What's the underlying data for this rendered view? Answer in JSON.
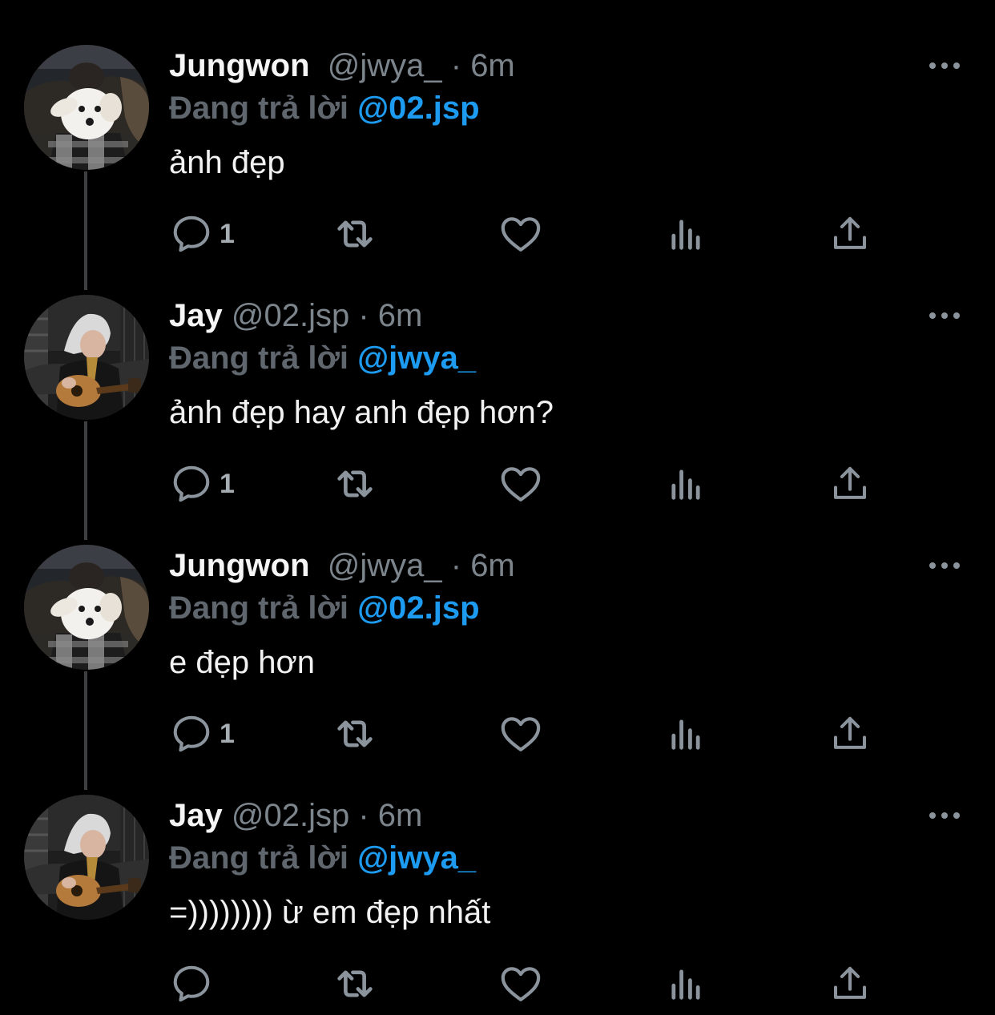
{
  "colors": {
    "background": "#000000",
    "name": "#f5f5f5",
    "meta": "#7c848c",
    "replying": "#5f666d",
    "mention": "#1d9bf0",
    "icon": "#8b949c",
    "thread_line": "#3d3f41"
  },
  "tweets": [
    {
      "name": "Jungwon",
      "handle": "@jwya_",
      "separator": " · ",
      "time": "6m",
      "replying_label": "Đang trả lời ",
      "replying_to": "@02.jsp",
      "text": "ảnh đẹp",
      "reply_count": "1",
      "avatar_icon": "avatar-dog"
    },
    {
      "name": "Jay",
      "handle": "@02.jsp",
      "separator": " · ",
      "time": "6m",
      "replying_label": "Đang trả lời ",
      "replying_to": "@jwya_",
      "text": "ảnh đẹp hay anh đẹp hơn?",
      "reply_count": "1",
      "avatar_icon": "avatar-guitar"
    },
    {
      "name": "Jungwon",
      "handle": "@jwya_",
      "separator": " · ",
      "time": "6m",
      "replying_label": "Đang trả lời ",
      "replying_to": "@02.jsp",
      "text": "e đẹp hơn",
      "reply_count": "1",
      "avatar_icon": "avatar-dog"
    },
    {
      "name": "Jay",
      "handle": "@02.jsp",
      "separator": " · ",
      "time": "6m",
      "replying_label": "Đang trả lời ",
      "replying_to": "@jwya_",
      "text": "=)))))))) ừ em đẹp nhất",
      "reply_count": "",
      "avatar_icon": "avatar-guitar"
    }
  ],
  "icons": [
    "reply-icon",
    "retweet-icon",
    "like-icon",
    "views-icon",
    "share-icon",
    "more-icon"
  ]
}
